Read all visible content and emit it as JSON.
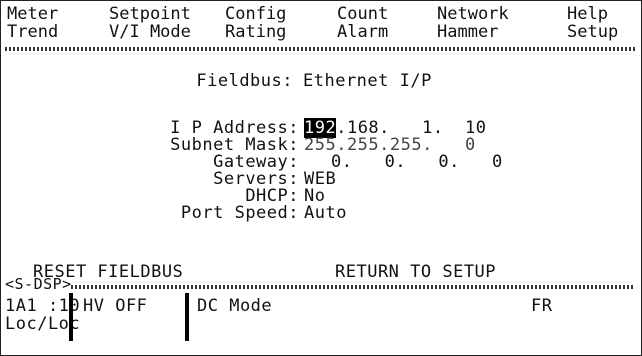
{
  "menu": {
    "items": [
      {
        "top": "Meter",
        "bottom": "Trend"
      },
      {
        "top": "Setpoint",
        "bottom": "V/I Mode"
      },
      {
        "top": "Config",
        "bottom": "Rating"
      },
      {
        "top": "Count",
        "bottom": "Alarm"
      },
      {
        "top": "Network",
        "bottom": "Hammer"
      },
      {
        "top": "Help",
        "bottom": "Setup"
      }
    ]
  },
  "fieldbus": {
    "label": "Fieldbus:",
    "value": "Ethernet I/P"
  },
  "fields": {
    "ip_label": "I P Address:",
    "ip_o1": "192",
    "ip_rest": ".168.   1.  10",
    "subnet_label": "Subnet Mask:",
    "subnet_value": "255.255.255.   0",
    "gateway_label": "Gateway:",
    "gateway_value": "0.   0.   0.   0",
    "servers_label": "Servers:",
    "servers_value": "WEB",
    "dhcp_label": "DHCP:",
    "dhcp_value": "No",
    "port_label": "Port Speed:",
    "port_value": "Auto"
  },
  "actions": {
    "reset": "RESET FIELDBUS",
    "return": "RETURN TO SETUP"
  },
  "status": {
    "sdsp": "<S-DSP>",
    "axis": "1A1 :10",
    "loc": "Loc/Loc",
    "hv": "HV OFF",
    "mode": "DC Mode",
    "fr": "FR"
  }
}
